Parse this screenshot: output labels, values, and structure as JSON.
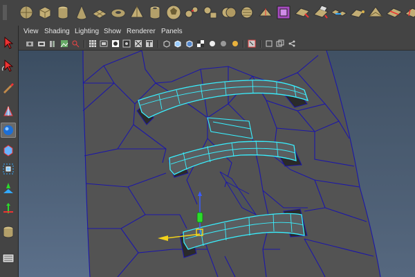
{
  "menubar": {
    "items": [
      {
        "label": "View"
      },
      {
        "label": "Shading"
      },
      {
        "label": "Lighting"
      },
      {
        "label": "Show"
      },
      {
        "label": "Renderer"
      },
      {
        "label": "Panels"
      }
    ]
  },
  "shelf": {
    "icons": [
      "poly-sphere-icon",
      "poly-cube-icon",
      "poly-cylinder-icon",
      "poly-cone-icon",
      "poly-plane-icon",
      "poly-torus-icon",
      "poly-pyramid-icon",
      "poly-pipe-icon",
      "poly-soccer-ball-icon",
      "combine-icon",
      "separate-icon",
      "boolean-icon",
      "smooth-icon",
      "mirror-icon",
      "extract-icon",
      "bevel-icon",
      "extrude-icon",
      "bridge-icon",
      "append-polygon-icon",
      "wedge-icon",
      "insert-edge-loop-icon",
      "split-polygon-icon"
    ],
    "accent_purple": "#a64bbf",
    "accent_gold": "#d9b24a"
  },
  "tools": [
    "select-tool-icon",
    "lasso-tool-icon",
    "paint-select-icon",
    "move-tool-icon",
    "rotate-tool-icon",
    "scale-tool-icon",
    "soft-mod-icon",
    "show-manipulator-icon",
    "last-tool-icon",
    "cylinder-tool-icon",
    "outliner-icon"
  ],
  "viewport": {
    "wire_color": "#1c17a8",
    "selected_wire_color": "#39f0ff",
    "mesh_color": "#535353",
    "background_top": "#3b4d61",
    "background_bottom": "#5c708a",
    "manipulator": {
      "x_color": "#f2d21a",
      "y_color": "#2bdc2b",
      "z_color": "#3a5cff"
    }
  }
}
